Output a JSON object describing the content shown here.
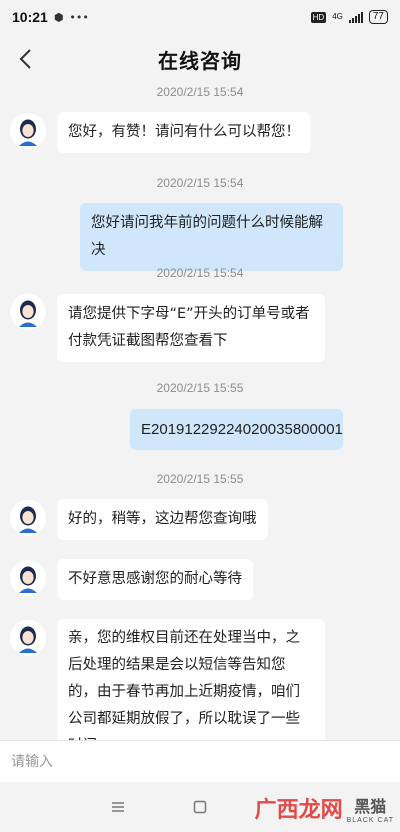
{
  "status_bar": {
    "time": "10:21",
    "hd": "HD",
    "network": "4G",
    "battery": "77"
  },
  "header": {
    "title": "在线咨询"
  },
  "messages": [
    {
      "timestamp": "2020/2/15 15:54",
      "side": "left",
      "text": "您好，有赞！请问有什么可以帮您！"
    },
    {
      "timestamp": "2020/2/15 15:54",
      "side": "right",
      "text": "您好请问我年前的问题什么时候能解决"
    },
    {
      "timestamp": "2020/2/15 15:54",
      "side": "left",
      "text": "请您提供下字母“E”开头的订单号或者付款凭证截图帮您查看下"
    },
    {
      "timestamp": "2020/2/15 15:55",
      "side": "right",
      "text": "E20191229224020035800001"
    },
    {
      "timestamp": "2020/2/15 15:55",
      "side": "left",
      "text": "好的，稍等，这边帮您查询哦"
    },
    {
      "timestamp": "",
      "side": "left",
      "text": "不好意思感谢您的耐心等待"
    },
    {
      "timestamp": "",
      "side": "left",
      "text": "亲，您的维权目前还在处理当中，之后处理的结果是会以短信等告知您的，由于春节再加上近期疫情，咱们公司都延期放假了，所以耽误了一些时间"
    }
  ],
  "input": {
    "placeholder": "请输入",
    "value": ""
  },
  "watermark": {
    "text": "广西龙网",
    "logo_text": "黑猫",
    "logo_sub": "BLACK CAT"
  },
  "icons": {
    "back": "chevron-left-icon",
    "menu": "menu-icon",
    "home": "square-home-icon"
  }
}
